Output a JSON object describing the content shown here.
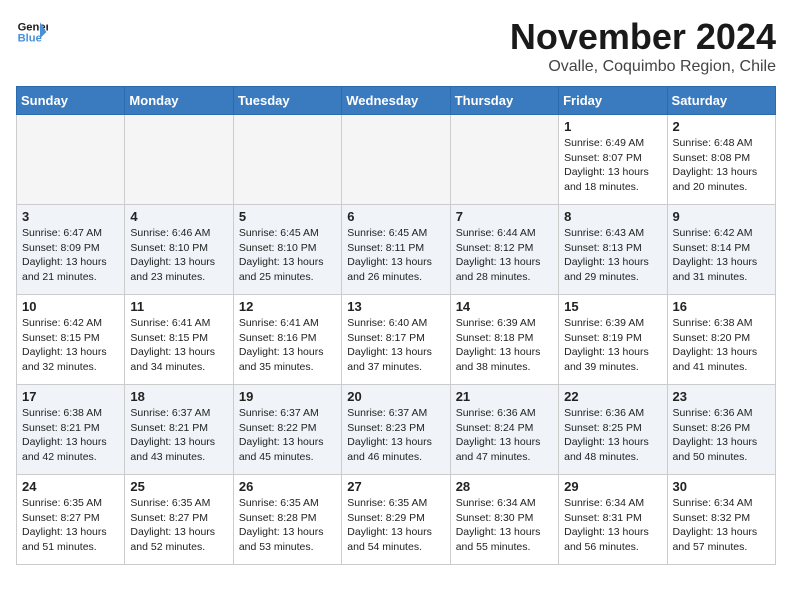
{
  "header": {
    "logo_line1": "General",
    "logo_line2": "Blue",
    "month": "November 2024",
    "location": "Ovalle, Coquimbo Region, Chile"
  },
  "weekdays": [
    "Sunday",
    "Monday",
    "Tuesday",
    "Wednesday",
    "Thursday",
    "Friday",
    "Saturday"
  ],
  "weeks": [
    [
      {
        "day": "",
        "text": ""
      },
      {
        "day": "",
        "text": ""
      },
      {
        "day": "",
        "text": ""
      },
      {
        "day": "",
        "text": ""
      },
      {
        "day": "",
        "text": ""
      },
      {
        "day": "1",
        "text": "Sunrise: 6:49 AM\nSunset: 8:07 PM\nDaylight: 13 hours and 18 minutes."
      },
      {
        "day": "2",
        "text": "Sunrise: 6:48 AM\nSunset: 8:08 PM\nDaylight: 13 hours and 20 minutes."
      }
    ],
    [
      {
        "day": "3",
        "text": "Sunrise: 6:47 AM\nSunset: 8:09 PM\nDaylight: 13 hours and 21 minutes."
      },
      {
        "day": "4",
        "text": "Sunrise: 6:46 AM\nSunset: 8:10 PM\nDaylight: 13 hours and 23 minutes."
      },
      {
        "day": "5",
        "text": "Sunrise: 6:45 AM\nSunset: 8:10 PM\nDaylight: 13 hours and 25 minutes."
      },
      {
        "day": "6",
        "text": "Sunrise: 6:45 AM\nSunset: 8:11 PM\nDaylight: 13 hours and 26 minutes."
      },
      {
        "day": "7",
        "text": "Sunrise: 6:44 AM\nSunset: 8:12 PM\nDaylight: 13 hours and 28 minutes."
      },
      {
        "day": "8",
        "text": "Sunrise: 6:43 AM\nSunset: 8:13 PM\nDaylight: 13 hours and 29 minutes."
      },
      {
        "day": "9",
        "text": "Sunrise: 6:42 AM\nSunset: 8:14 PM\nDaylight: 13 hours and 31 minutes."
      }
    ],
    [
      {
        "day": "10",
        "text": "Sunrise: 6:42 AM\nSunset: 8:15 PM\nDaylight: 13 hours and 32 minutes."
      },
      {
        "day": "11",
        "text": "Sunrise: 6:41 AM\nSunset: 8:15 PM\nDaylight: 13 hours and 34 minutes."
      },
      {
        "day": "12",
        "text": "Sunrise: 6:41 AM\nSunset: 8:16 PM\nDaylight: 13 hours and 35 minutes."
      },
      {
        "day": "13",
        "text": "Sunrise: 6:40 AM\nSunset: 8:17 PM\nDaylight: 13 hours and 37 minutes."
      },
      {
        "day": "14",
        "text": "Sunrise: 6:39 AM\nSunset: 8:18 PM\nDaylight: 13 hours and 38 minutes."
      },
      {
        "day": "15",
        "text": "Sunrise: 6:39 AM\nSunset: 8:19 PM\nDaylight: 13 hours and 39 minutes."
      },
      {
        "day": "16",
        "text": "Sunrise: 6:38 AM\nSunset: 8:20 PM\nDaylight: 13 hours and 41 minutes."
      }
    ],
    [
      {
        "day": "17",
        "text": "Sunrise: 6:38 AM\nSunset: 8:21 PM\nDaylight: 13 hours and 42 minutes."
      },
      {
        "day": "18",
        "text": "Sunrise: 6:37 AM\nSunset: 8:21 PM\nDaylight: 13 hours and 43 minutes."
      },
      {
        "day": "19",
        "text": "Sunrise: 6:37 AM\nSunset: 8:22 PM\nDaylight: 13 hours and 45 minutes."
      },
      {
        "day": "20",
        "text": "Sunrise: 6:37 AM\nSunset: 8:23 PM\nDaylight: 13 hours and 46 minutes."
      },
      {
        "day": "21",
        "text": "Sunrise: 6:36 AM\nSunset: 8:24 PM\nDaylight: 13 hours and 47 minutes."
      },
      {
        "day": "22",
        "text": "Sunrise: 6:36 AM\nSunset: 8:25 PM\nDaylight: 13 hours and 48 minutes."
      },
      {
        "day": "23",
        "text": "Sunrise: 6:36 AM\nSunset: 8:26 PM\nDaylight: 13 hours and 50 minutes."
      }
    ],
    [
      {
        "day": "24",
        "text": "Sunrise: 6:35 AM\nSunset: 8:27 PM\nDaylight: 13 hours and 51 minutes."
      },
      {
        "day": "25",
        "text": "Sunrise: 6:35 AM\nSunset: 8:27 PM\nDaylight: 13 hours and 52 minutes."
      },
      {
        "day": "26",
        "text": "Sunrise: 6:35 AM\nSunset: 8:28 PM\nDaylight: 13 hours and 53 minutes."
      },
      {
        "day": "27",
        "text": "Sunrise: 6:35 AM\nSunset: 8:29 PM\nDaylight: 13 hours and 54 minutes."
      },
      {
        "day": "28",
        "text": "Sunrise: 6:34 AM\nSunset: 8:30 PM\nDaylight: 13 hours and 55 minutes."
      },
      {
        "day": "29",
        "text": "Sunrise: 6:34 AM\nSunset: 8:31 PM\nDaylight: 13 hours and 56 minutes."
      },
      {
        "day": "30",
        "text": "Sunrise: 6:34 AM\nSunset: 8:32 PM\nDaylight: 13 hours and 57 minutes."
      }
    ]
  ]
}
